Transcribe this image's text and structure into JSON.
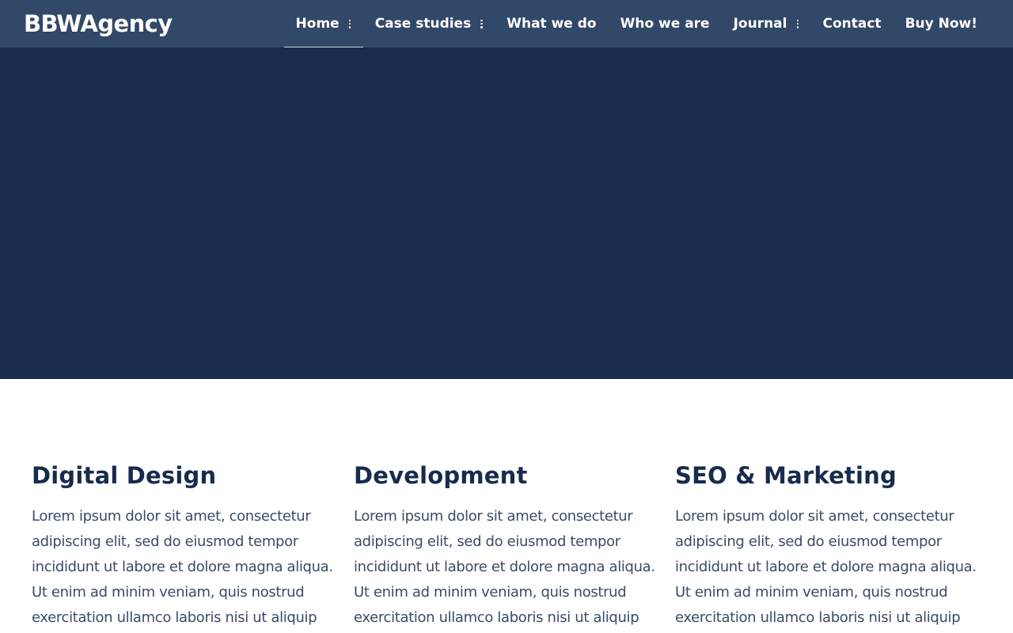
{
  "colors": {
    "hero_bg": "#1a2d4e",
    "navbar_bg": "#324868",
    "heading": "#172b4d",
    "body_text": "#3a4b66"
  },
  "header": {
    "logo": "BBWAgency",
    "nav": [
      {
        "label": "Home",
        "has_submenu": true,
        "active": true
      },
      {
        "label": "Case studies",
        "has_submenu": true,
        "active": false
      },
      {
        "label": "What we do",
        "has_submenu": false,
        "active": false
      },
      {
        "label": "Who we are",
        "has_submenu": false,
        "active": false
      },
      {
        "label": "Journal",
        "has_submenu": true,
        "active": false
      },
      {
        "label": "Contact",
        "has_submenu": false,
        "active": false
      },
      {
        "label": "Buy Now!",
        "has_submenu": false,
        "active": false
      }
    ]
  },
  "features": [
    {
      "title": "Digital Design",
      "text": "Lorem ipsum dolor sit amet, consectetur adipiscing elit, sed do eiusmod tempor incididunt ut labore et dolore magna aliqua. Ut enim ad minim veniam, quis nostrud exercitation ullamco laboris nisi ut aliquip"
    },
    {
      "title": "Development",
      "text": "Lorem ipsum dolor sit amet, consectetur adipiscing elit, sed do eiusmod tempor incididunt ut labore et dolore magna aliqua. Ut enim ad minim veniam, quis nostrud exercitation ullamco laboris nisi ut aliquip"
    },
    {
      "title": "SEO & Marketing",
      "text": "Lorem ipsum dolor sit amet, consectetur adipiscing elit, sed do eiusmod tempor incididunt ut labore et dolore magna aliqua. Ut enim ad minim veniam, quis nostrud exercitation ullamco laboris nisi ut aliquip"
    }
  ]
}
